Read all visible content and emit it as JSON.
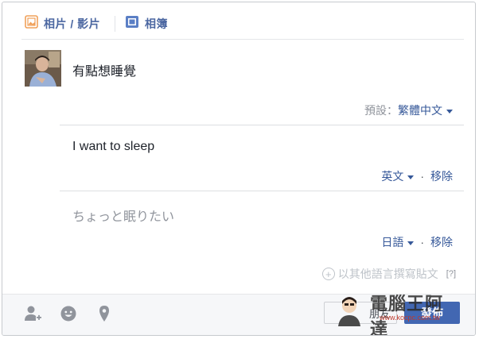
{
  "tabs": {
    "photo_video_label": "相片 / 影片",
    "album_label": "相簿"
  },
  "post": {
    "text": "有點想睡覺"
  },
  "default_language": {
    "label": "預設：",
    "value": "繁體中文"
  },
  "translations": [
    {
      "text": "I want to sleep",
      "language": "英文",
      "remove_label": "移除"
    },
    {
      "placeholder": "ちょっと眠りたい",
      "language": "日語",
      "remove_label": "移除"
    }
  ],
  "separator": "·",
  "add_language": {
    "label": "以其他語言撰寫貼文",
    "help": "[?]"
  },
  "footer": {
    "privacy_label": "朋友",
    "post_label": "發佈"
  },
  "watermark": {
    "text": "電腦王阿達",
    "url": "www.kocpc.com.tw"
  },
  "colors": {
    "link": "#365899",
    "button": "#4267b2",
    "photo_icon": "#f0a059",
    "album_icon": "#5b7fc5"
  }
}
